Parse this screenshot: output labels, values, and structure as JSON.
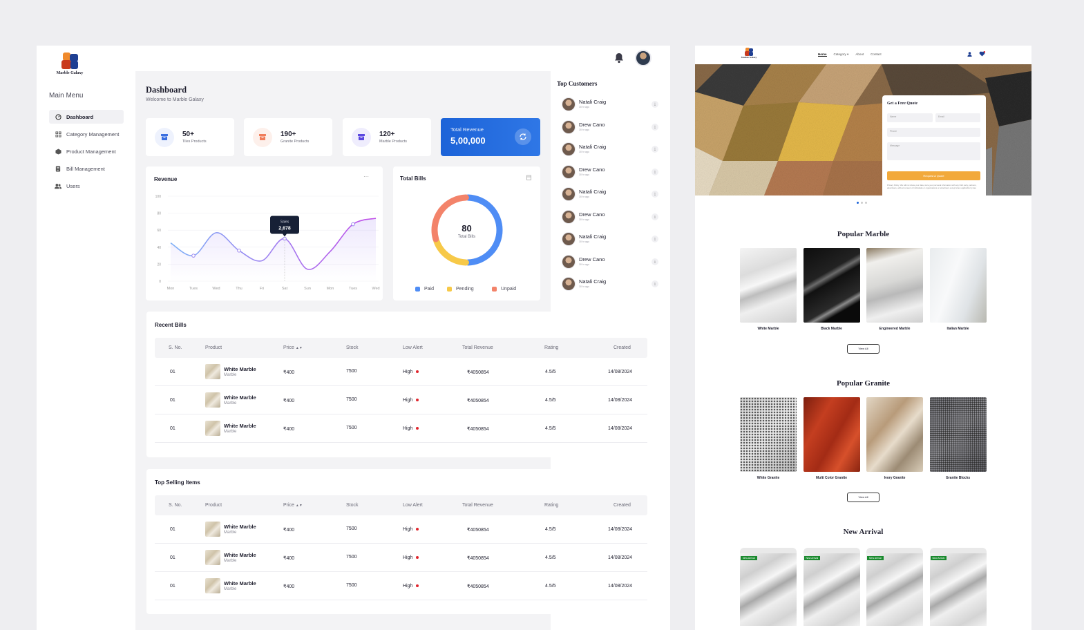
{
  "brand": {
    "name": "Marble Galaxy"
  },
  "sidebar": {
    "menu_title": "Main Menu",
    "items": [
      {
        "label": "Dashboard",
        "icon": "dashboard-icon"
      },
      {
        "label": "Category  Management",
        "icon": "category-icon"
      },
      {
        "label": "Product Management",
        "icon": "product-icon"
      },
      {
        "label": "Bill Management",
        "icon": "bill-icon"
      },
      {
        "label": "Users",
        "icon": "users-icon"
      }
    ]
  },
  "header": {
    "title": "Dashboard",
    "subtitle": "Welcome to Marble Galaxy"
  },
  "stats": [
    {
      "value": "50+",
      "label": "Tiles Products",
      "color": "#3b6fe0",
      "bg": "#eef2fd"
    },
    {
      "value": "190+",
      "label": "Granite Products",
      "color": "#f07d5a",
      "bg": "#fdf0eb"
    },
    {
      "value": "120+",
      "label": "Marble Products",
      "color": "#5a47e0",
      "bg": "#efedfd"
    }
  ],
  "revenue_card": {
    "label": "Total Revenue",
    "value": "5,00,000"
  },
  "revenue_chart": {
    "title": "Revenue",
    "menu": "···",
    "tooltip": {
      "label": "Sales",
      "value": "2,678"
    }
  },
  "chart_data": {
    "type": "line",
    "x": [
      "Mon",
      "Tues",
      "Wed",
      "Thu",
      "Fri",
      "Sat",
      "Sun",
      "Mon",
      "Tues",
      "Wed"
    ],
    "ylim": [
      0,
      100
    ],
    "yticks": [
      "100",
      "80",
      "60",
      "40",
      "20",
      "0"
    ],
    "series": [
      {
        "values": [
          45,
          30,
          57,
          36,
          24,
          50,
          14,
          35,
          67,
          74
        ]
      }
    ]
  },
  "bills": {
    "title": "Total Bills",
    "total": "80",
    "total_label": "Total Bills",
    "segments": [
      {
        "name": "Paid",
        "value": 50,
        "color": "#4f8df5"
      },
      {
        "name": "Pending",
        "value": 20,
        "color": "#f7c948"
      },
      {
        "name": "Unpaid",
        "value": 30,
        "color": "#f3836a"
      }
    ]
  },
  "customers": {
    "title": "Top Customers",
    "rows": [
      {
        "name": "Natali Craig",
        "time": "30 hr ago"
      },
      {
        "name": "Drew Cano",
        "time": "30 hr ago"
      },
      {
        "name": "Natali Craig",
        "time": "30 hr ago"
      },
      {
        "name": "Drew Cano",
        "time": "30 hr ago"
      },
      {
        "name": "Natali Craig",
        "time": "30 hr ago"
      },
      {
        "name": "Drew Cano",
        "time": "30 hr ago"
      },
      {
        "name": "Natali Craig",
        "time": "30 hr ago"
      },
      {
        "name": "Drew Cano",
        "time": "30 hr ago"
      },
      {
        "name": "Natali Craig",
        "time": "30 hr ago"
      }
    ]
  },
  "table_headers": [
    "S. No.",
    "Product",
    "Price",
    "Stock",
    "Low Alert",
    "Total Revenue",
    "Rating",
    "Created"
  ],
  "recent_bills": {
    "title": "Recent Bills",
    "rows": [
      {
        "sno": "01",
        "product": "White Marble",
        "category": "Marble",
        "price": "₹400",
        "stock": "7500",
        "alert": "High",
        "revenue": "₹4050854",
        "rating": "4.5/5",
        "created": "14/08/2024"
      },
      {
        "sno": "01",
        "product": "White Marble",
        "category": "Marble",
        "price": "₹400",
        "stock": "7500",
        "alert": "High",
        "revenue": "₹4050854",
        "rating": "4.5/5",
        "created": "14/08/2024"
      },
      {
        "sno": "01",
        "product": "White Marble",
        "category": "Marble",
        "price": "₹400",
        "stock": "7500",
        "alert": "High",
        "revenue": "₹4050854",
        "rating": "4.5/5",
        "created": "14/08/2024"
      }
    ]
  },
  "top_selling": {
    "title": "Top Selling Items",
    "rows": [
      {
        "sno": "01",
        "product": "White Marble",
        "category": "Marble",
        "price": "₹400",
        "stock": "7500",
        "alert": "High",
        "revenue": "₹4050854",
        "rating": "4.5/5",
        "created": "14/08/2024"
      },
      {
        "sno": "01",
        "product": "White Marble",
        "category": "Marble",
        "price": "₹400",
        "stock": "7500",
        "alert": "High",
        "revenue": "₹4050854",
        "rating": "4.5/5",
        "created": "14/08/2024"
      },
      {
        "sno": "01",
        "product": "White Marble",
        "category": "Marble",
        "price": "₹400",
        "stock": "7500",
        "alert": "High",
        "revenue": "₹4050854",
        "rating": "4.5/5",
        "created": "14/08/2024"
      }
    ]
  },
  "site": {
    "nav": [
      "Home",
      "Category",
      "About",
      "Contact"
    ],
    "quote": {
      "title": "Get a Free Quote",
      "name": "Name",
      "email": "Email",
      "phone": "Phone",
      "message": "Message",
      "button": "Request A Quote",
      "policy": "Privacy Policy: We will not share your data, store your personal information with any third party, partners, advertisers, without consent of individuals or organisations or advertisers except when applicable by law."
    },
    "popular_marble": {
      "title": "Popular Marble",
      "items": [
        "White Marble",
        "Black Marble",
        "Engineered Marble",
        "Italian Marble"
      ],
      "view_all": "View All"
    },
    "popular_granite": {
      "title": "Popular  Granite",
      "items": [
        "White Granite",
        "Multi Color Granite",
        "Ivory Granite",
        "Granite Blocks"
      ],
      "view_all": "View All"
    },
    "new_arrival": {
      "title": "New Arrival",
      "badge": "New Arrival"
    }
  }
}
